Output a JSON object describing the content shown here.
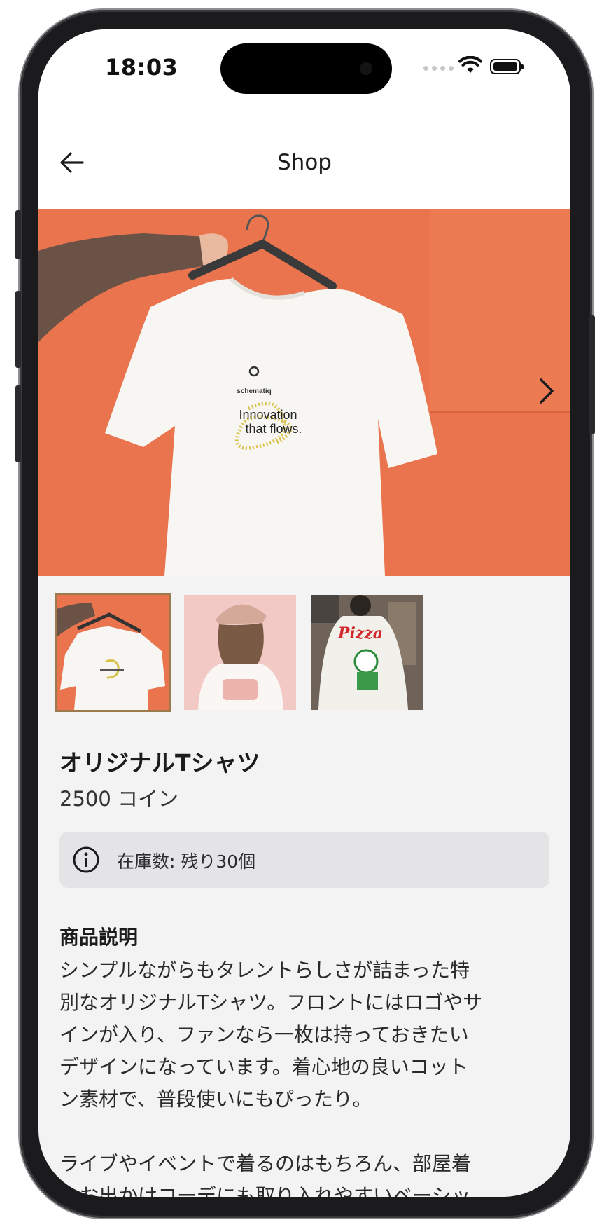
{
  "status_bar": {
    "time": "18:03"
  },
  "nav": {
    "title": "Shop"
  },
  "hero": {
    "shirt_brand": "schematiq",
    "shirt_slogan_line1": "Innovation",
    "shirt_slogan_line2": "that flows."
  },
  "thumbnails": [
    {
      "name": "thumb-orange-tshirt",
      "selected": true
    },
    {
      "name": "thumb-pink-tshirt",
      "selected": false
    },
    {
      "name": "thumb-pizza-tshirt",
      "selected": false,
      "label": "Pizza"
    }
  ],
  "product": {
    "name": "オリジナルTシャツ",
    "price": "2500 コイン",
    "stock": "在庫数: 残り30個"
  },
  "description": {
    "title": "商品説明",
    "paragraph1": "シンプルながらもタレントらしさが詰まった特\n別なオリジナルTシャツ。フロントにはロゴやサ\nインが入り、ファンなら一枚は持っておきたい\nデザインになっています。着心地の良いコット\nン素材で、普段使いにもぴったり。",
    "paragraph2": "ライブやイベントで着るのはもちろん、部屋着\nやお出かけコーデにも取り入れやすいベーシッ"
  },
  "colors": {
    "accent_orange": "#e9744d",
    "selected_border": "#9b7a4e",
    "background": "#f3f3f3"
  }
}
